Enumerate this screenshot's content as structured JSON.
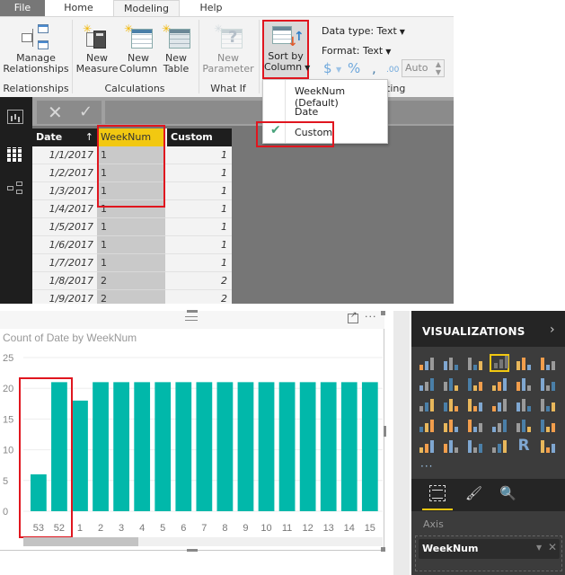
{
  "ribbon": {
    "tabs": [
      "File",
      "Home",
      "Modeling",
      "Help"
    ],
    "active_tab": "Modeling",
    "groups": {
      "relationships": {
        "label": "Relationships",
        "buttons": [
          {
            "label1": "Manage",
            "label2": "Relationships",
            "icon": "manage-relationships-icon"
          }
        ]
      },
      "calculations": {
        "label": "Calculations",
        "buttons": [
          {
            "label1": "New",
            "label2": "Measure",
            "icon": "new-measure-icon"
          },
          {
            "label1": "New",
            "label2": "Column",
            "icon": "new-column-icon"
          },
          {
            "label1": "New",
            "label2": "Table",
            "icon": "new-table-icon"
          }
        ]
      },
      "what_if": {
        "label": "What If",
        "buttons": [
          {
            "label1": "New",
            "label2": "Parameter",
            "icon": "new-parameter-icon",
            "disabled": true
          }
        ]
      },
      "sort": {
        "label1": "Sort by",
        "label2": "Column",
        "icon": "sort-by-column-icon"
      },
      "formatting": {
        "label_partial": "ting",
        "data_type": "Data type: Text",
        "format": "Format: Text",
        "currency_symbol": "$",
        "percent_symbol": "%",
        "comma_symbol": ",",
        "decimal_symbol": ".00",
        "auto_value": "Auto"
      }
    }
  },
  "sort_menu": {
    "items": [
      "WeekNum (Default)",
      "Date",
      "Custom"
    ],
    "checked": "Custom"
  },
  "formula_bar": {
    "cancel_icon": "✕",
    "commit_icon": "✓"
  },
  "data_grid": {
    "columns": [
      "Date",
      "WeekNum",
      "Custom"
    ],
    "sort_indicator": "↑",
    "rows": [
      [
        "1/1/2017",
        "1",
        "1"
      ],
      [
        "1/2/2017",
        "1",
        "1"
      ],
      [
        "1/3/2017",
        "1",
        "1"
      ],
      [
        "1/4/2017",
        "1",
        "1"
      ],
      [
        "1/5/2017",
        "1",
        "1"
      ],
      [
        "1/6/2017",
        "1",
        "1"
      ],
      [
        "1/7/2017",
        "1",
        "1"
      ],
      [
        "1/8/2017",
        "2",
        "2"
      ],
      [
        "1/9/2017",
        "2",
        "2"
      ]
    ]
  },
  "visual": {
    "more_label": "···"
  },
  "chart_data": {
    "type": "bar",
    "title": "Count of Date by WeekNum",
    "categories": [
      "53",
      "52",
      "1",
      "2",
      "3",
      "4",
      "5",
      "6",
      "7",
      "8",
      "9",
      "10",
      "11",
      "12",
      "13",
      "14",
      "15"
    ],
    "values": [
      6,
      21,
      18,
      21,
      21,
      21,
      21,
      21,
      21,
      21,
      21,
      21,
      21,
      21,
      21,
      21,
      21
    ],
    "xlabel": "",
    "ylabel": "",
    "ylim": [
      0,
      25
    ],
    "yticks": [
      0,
      5,
      10,
      15,
      20,
      25
    ],
    "grid": true,
    "bar_color": "#01B8AA"
  },
  "viz_pane": {
    "title": "VISUALIZATIONS",
    "chevron": "›",
    "more": "···",
    "axis_label": "Axis",
    "axis_field": "WeekNum",
    "visual_types": [
      "stacked-bar",
      "stacked-column",
      "clustered-bar",
      "clustered-column",
      "100-stacked-bar",
      "100-stacked-column",
      "line",
      "area",
      "stacked-area",
      "line-and-stacked-column",
      "line-and-clustered-column",
      "ribbon",
      "waterfall",
      "scatter",
      "pie",
      "donut",
      "treemap",
      "map",
      "filled-map",
      "shape-map",
      "funnel",
      "gauge",
      "card",
      "multi-row-card",
      "kpi",
      "slicer",
      "table",
      "matrix",
      "r-script",
      "globe"
    ],
    "selected_visual": "clustered-column"
  },
  "colors": {
    "accent_yellow": "#F2C811",
    "highlight_red": "#E0161F",
    "bar_teal": "#01B8AA"
  }
}
